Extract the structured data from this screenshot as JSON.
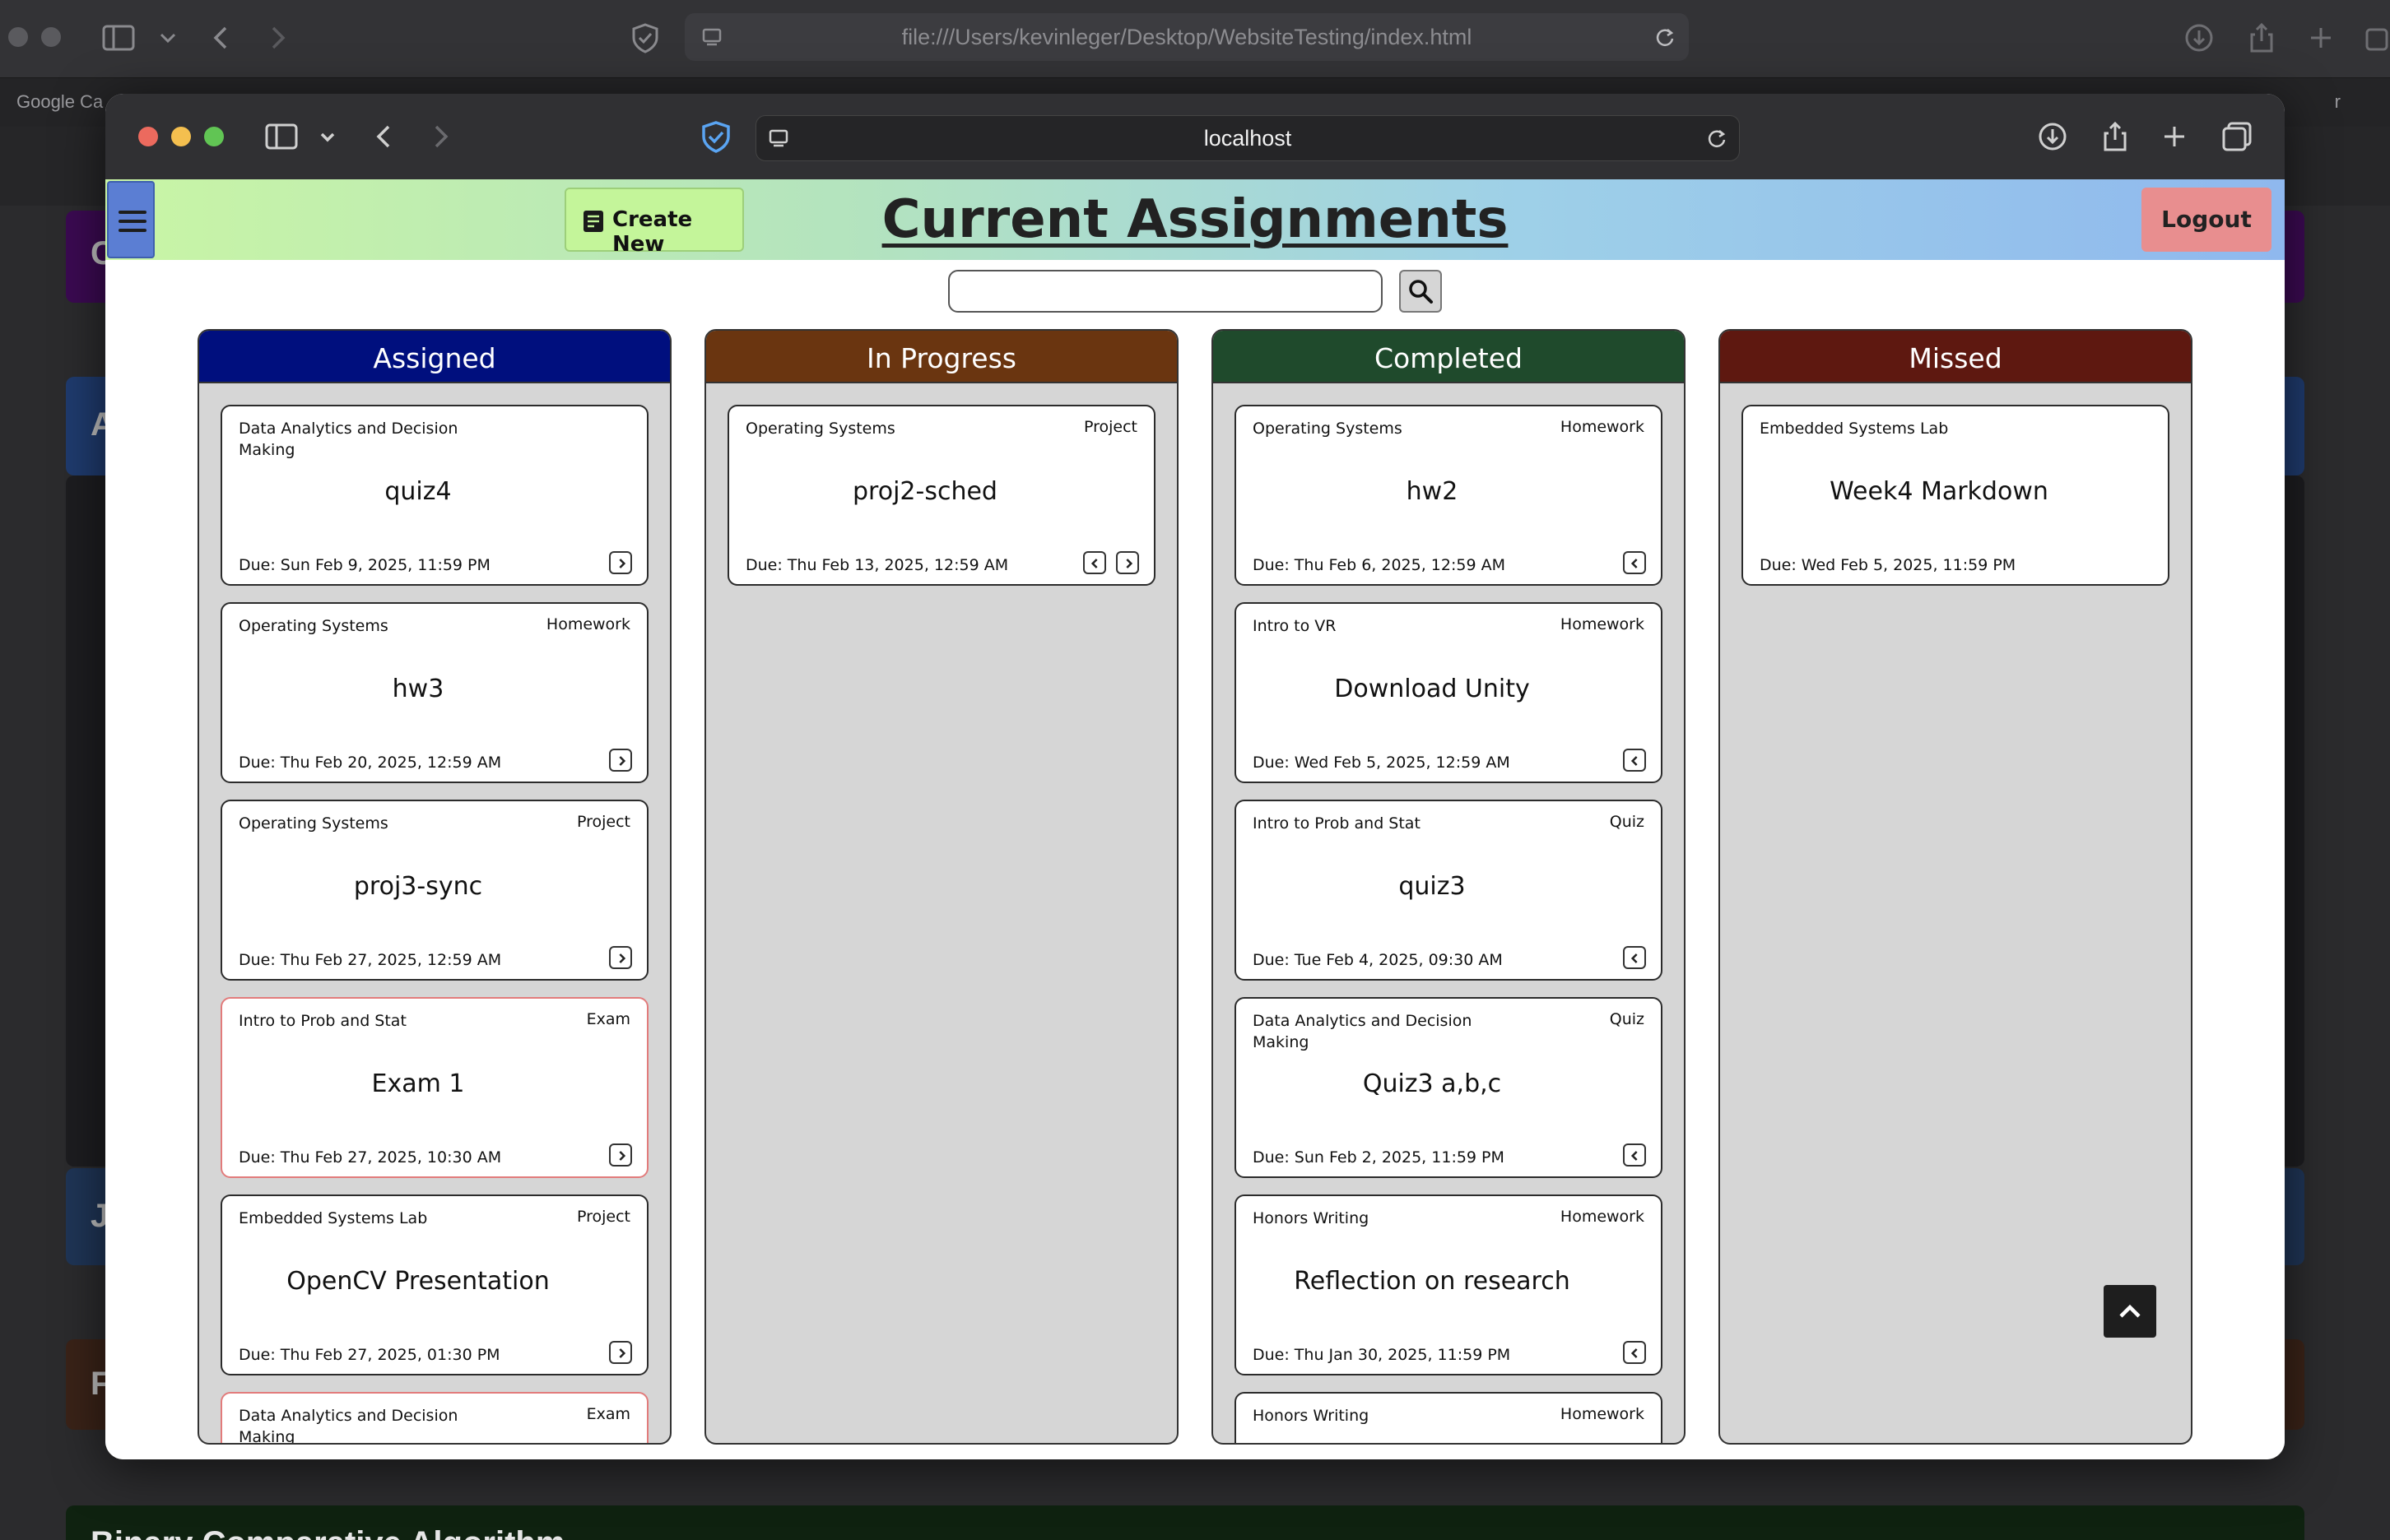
{
  "outer_browser": {
    "url": "file:///Users/kevinleger/Desktop/WebsiteTesting/index.html",
    "tab_left": "Google Ca",
    "tab_right": "r"
  },
  "background_page": {
    "letters": [
      "C",
      "A",
      "J",
      "F"
    ],
    "bottom_heading": "Binary Comparative Algorithm"
  },
  "browser": {
    "url": "localhost"
  },
  "header": {
    "create_label": "Create New",
    "title": "Current Assignments",
    "logout_label": "Logout"
  },
  "search": {
    "value": "",
    "placeholder": ""
  },
  "colors": {
    "assigned": "#000f7e",
    "in_progress": "#6a3510",
    "completed": "#1f4a2c",
    "missed": "#5e1810",
    "exam_border": "#e27b7b"
  },
  "columns": [
    {
      "title": "Assigned",
      "cards": [
        {
          "course": "Data Analytics and Decision Making",
          "type": "",
          "title": "quiz4",
          "due": "Due: Sun Feb 9, 2025, 11:59 PM",
          "arrows": [
            "right"
          ]
        },
        {
          "course": "Operating Systems",
          "type": "Homework",
          "title": "hw3",
          "due": "Due: Thu Feb 20, 2025, 12:59 AM",
          "arrows": [
            "right"
          ]
        },
        {
          "course": "Operating Systems",
          "type": "Project",
          "title": "proj3-sync",
          "due": "Due: Thu Feb 27, 2025, 12:59 AM",
          "arrows": [
            "right"
          ]
        },
        {
          "course": "Intro to Prob and Stat",
          "type": "Exam",
          "title": "Exam 1",
          "due": "Due: Thu Feb 27, 2025, 10:30 AM",
          "arrows": [
            "right"
          ]
        },
        {
          "course": "Embedded Systems Lab",
          "type": "Project",
          "title": "OpenCV Presentation",
          "due": "Due: Thu Feb 27, 2025, 01:30 PM",
          "arrows": [
            "right"
          ]
        },
        {
          "course": "Data Analytics and Decision Making",
          "type": "Exam",
          "title": "",
          "due": "",
          "arrows": []
        }
      ]
    },
    {
      "title": "In Progress",
      "cards": [
        {
          "course": "Operating Systems",
          "type": "Project",
          "title": "proj2-sched",
          "due": "Due: Thu Feb 13, 2025, 12:59 AM",
          "arrows": [
            "left",
            "right"
          ]
        }
      ]
    },
    {
      "title": "Completed",
      "cards": [
        {
          "course": "Operating Systems",
          "type": "Homework",
          "title": "hw2",
          "due": "Due: Thu Feb 6, 2025, 12:59 AM",
          "arrows": [
            "left"
          ]
        },
        {
          "course": "Intro to VR",
          "type": "Homework",
          "title": "Download Unity",
          "due": "Due: Wed Feb 5, 2025, 12:59 AM",
          "arrows": [
            "left"
          ]
        },
        {
          "course": "Intro to Prob and Stat",
          "type": "Quiz",
          "title": "quiz3",
          "due": "Due: Tue Feb 4, 2025, 09:30 AM",
          "arrows": [
            "left"
          ]
        },
        {
          "course": "Data Analytics and Decision Making",
          "type": "Quiz",
          "title": "Quiz3 a,b,c",
          "due": "Due: Sun Feb 2, 2025, 11:59 PM",
          "arrows": [
            "left"
          ]
        },
        {
          "course": "Honors Writing",
          "type": "Homework",
          "title": "Reflection on research",
          "due": "Due: Thu Jan 30, 2025, 11:59 PM",
          "arrows": [
            "left"
          ]
        },
        {
          "course": "Honors Writing",
          "type": "Homework",
          "title": "",
          "due": "",
          "arrows": []
        }
      ]
    },
    {
      "title": "Missed",
      "cards": [
        {
          "course": "Embedded Systems Lab",
          "type": "",
          "title": "Week4 Markdown",
          "due": "Due: Wed Feb 5, 2025, 11:59 PM",
          "arrows": []
        }
      ]
    }
  ]
}
